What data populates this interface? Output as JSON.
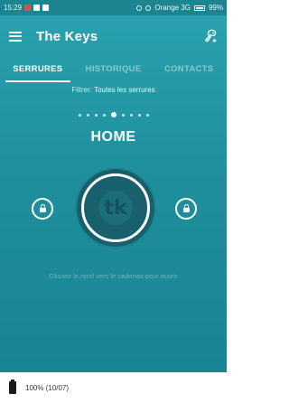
{
  "status_bar": {
    "time": "15:29",
    "carrier": "Orange 3G",
    "battery": "99%"
  },
  "app_bar": {
    "title": "The Keys",
    "menu_icon": "hamburger-menu-icon",
    "action_icon": "key-add-icon"
  },
  "tabs": [
    {
      "label": "SERRURES",
      "active": true
    },
    {
      "label": "HISTORIQUE",
      "active": false
    },
    {
      "label": "CONTACTS",
      "active": false
    }
  ],
  "filter": {
    "label": "Filtrer:",
    "value": "Toutes les serrures"
  },
  "pager": {
    "count": 9,
    "active_index": 4
  },
  "lock": {
    "name": "HOME",
    "logo_text": "tk",
    "hint": "Glissez le rond vers le cadenas pour ouvrir"
  },
  "footer": {
    "battery_text": "100% (10/07)"
  },
  "colors": {
    "primary": "#1f8f9c",
    "knob": "#17606c"
  }
}
